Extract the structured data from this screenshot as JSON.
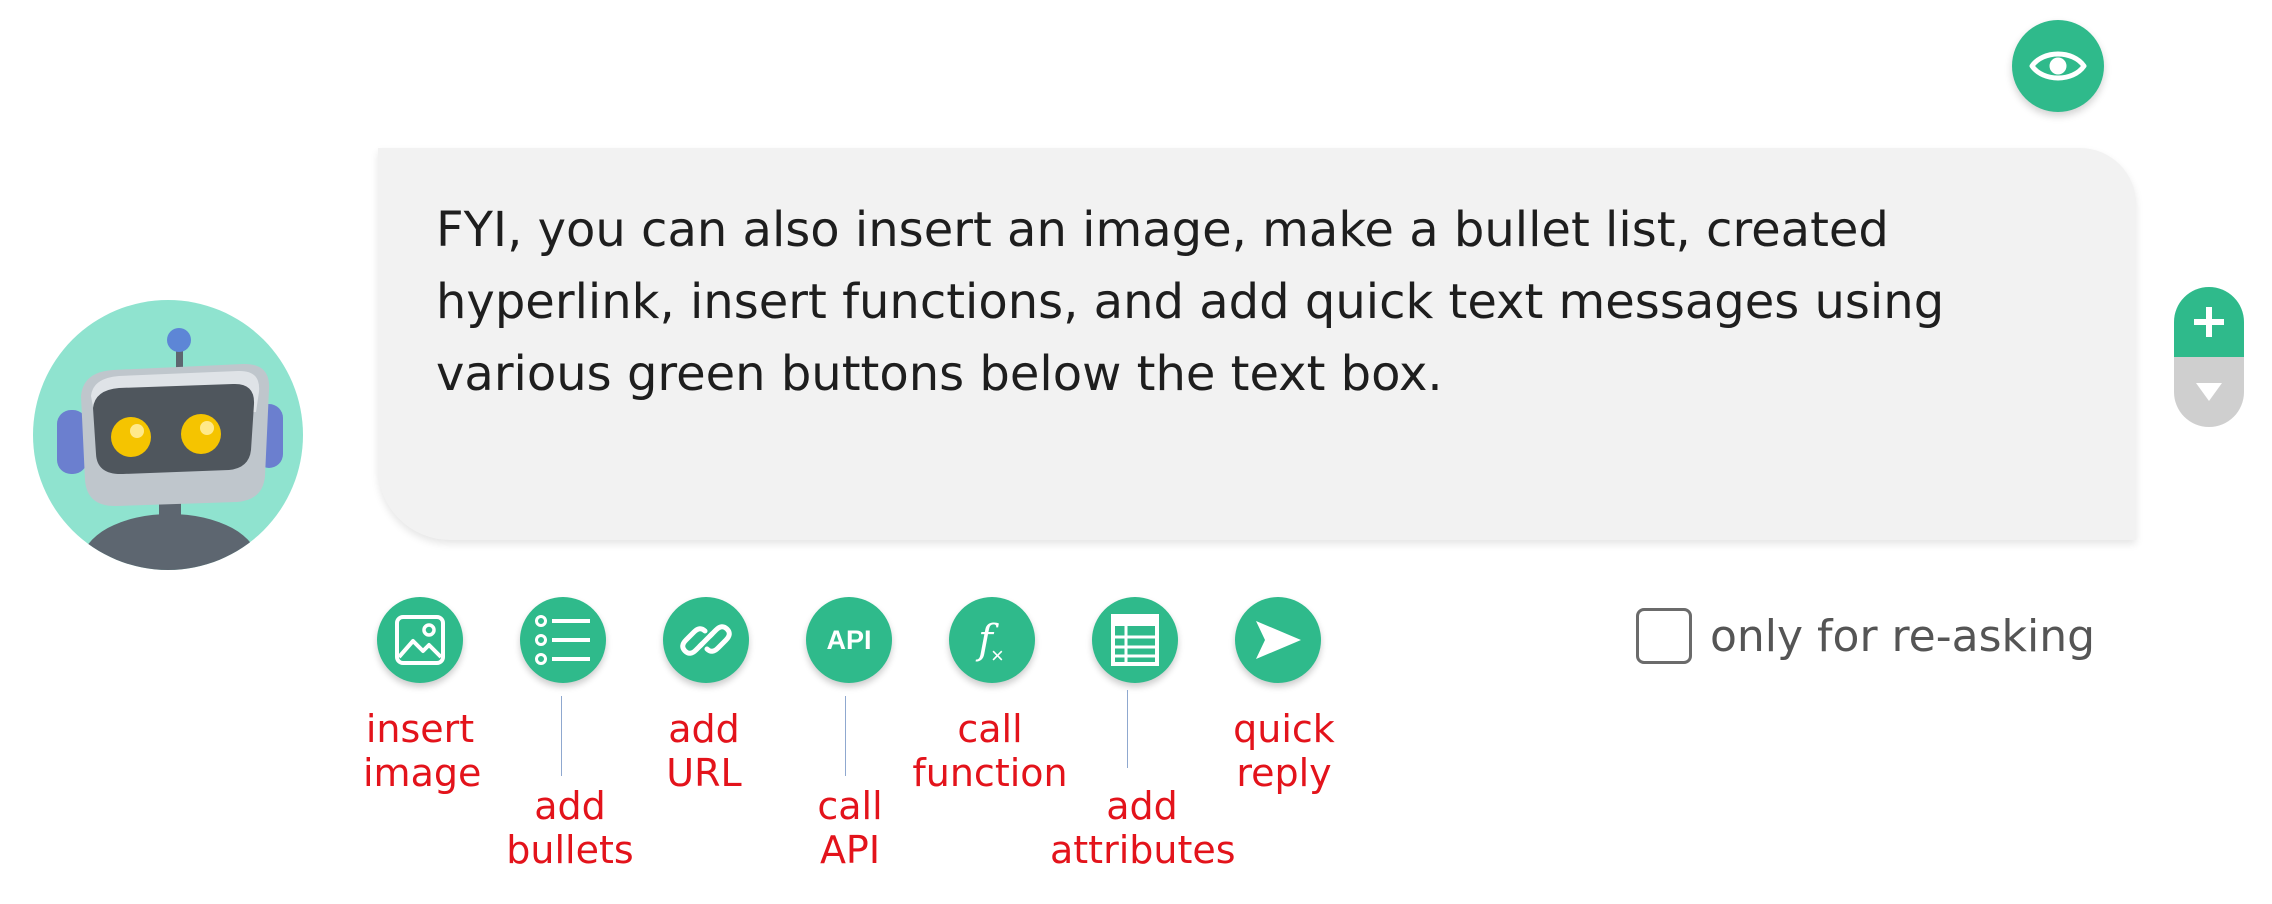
{
  "message": {
    "text": "FYI, you can also insert an image, make a bullet list, created hyperlink, insert functions, and add quick text messages using various green buttons below the text box."
  },
  "toolbar": {
    "api_label": "API",
    "fx_label": "f",
    "fx_sub": "×",
    "buttons": [
      {
        "icon": "image-icon",
        "label_line1": "insert",
        "label_line2": "image"
      },
      {
        "icon": "bullet-list-icon",
        "label_line1": "add",
        "label_line2": "bullets"
      },
      {
        "icon": "link-icon",
        "label_line1": "add",
        "label_line2": "URL"
      },
      {
        "icon": "api-icon",
        "label_line1": "call",
        "label_line2": "API"
      },
      {
        "icon": "function-icon",
        "label_line1": "call",
        "label_line2": "function"
      },
      {
        "icon": "table-icon",
        "label_line1": "add",
        "label_line2": "attributes"
      },
      {
        "icon": "send-icon",
        "label_line1": "quick",
        "label_line2": "reply"
      }
    ]
  },
  "reask": {
    "label": "only for re-asking",
    "checked": false
  },
  "colors": {
    "accent": "#2fba8b",
    "annotation": "#e3131b",
    "bubble": "#f2f2f2",
    "stepper_disabled": "#cfcfcf"
  }
}
